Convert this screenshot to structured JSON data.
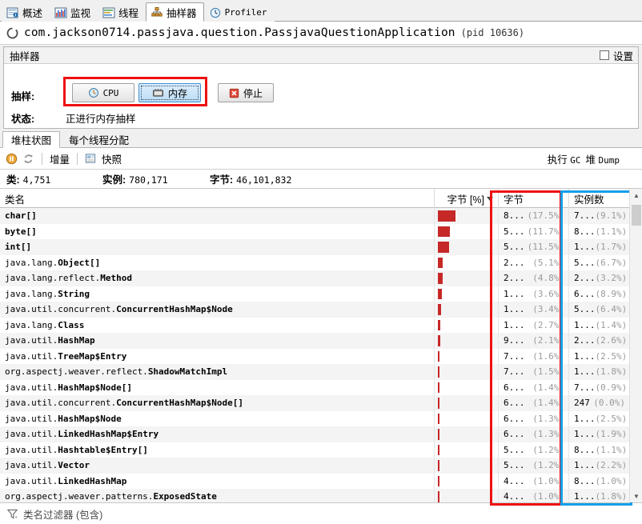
{
  "tabs": [
    {
      "label": "概述",
      "icon": "overview-icon",
      "active": false
    },
    {
      "label": "监视",
      "icon": "monitor-icon",
      "active": false
    },
    {
      "label": "线程",
      "icon": "threads-icon",
      "active": false
    },
    {
      "label": "抽样器",
      "icon": "sampler-icon",
      "active": true
    },
    {
      "label": "Profiler",
      "icon": "profiler-icon",
      "active": false
    }
  ],
  "header": {
    "app_name": "com.jackson0714.passjava.question.PassjavaQuestionApplication",
    "pid": "(pid 10636)",
    "status_icon": "loading-spinner-icon"
  },
  "panel": {
    "title": "抽样器",
    "settings_label": "设置",
    "settings_checked": false,
    "sampling_label": "抽样:",
    "status_label": "状态:",
    "status_value": "正进行内存抽样",
    "buttons": {
      "cpu": {
        "label": "CPU",
        "icon": "clock-icon"
      },
      "memory": {
        "label": "内存",
        "icon": "memory-chip-icon",
        "selected": true
      },
      "stop": {
        "label": "停止",
        "icon": "stop-red-x-icon"
      }
    }
  },
  "subtabs": [
    {
      "label": "堆柱状图",
      "active": true
    },
    {
      "label": "每个线程分配",
      "active": false
    }
  ],
  "toolbar": {
    "pause_icon": "pause-icon",
    "refresh_icon": "refresh-icon",
    "delta_label": "增量",
    "snapshot_icon": "snapshot-icon",
    "snapshot_label": "快照",
    "gc_prefix": "执行",
    "gc_label": "GC",
    "heap_prefix": "堆",
    "dump_label": "Dump"
  },
  "stats": {
    "classes_label": "类:",
    "classes_value": "4,751",
    "instances_label": "实例:",
    "instances_value": "780,171",
    "bytes_label": "字节:",
    "bytes_value": "46,101,832"
  },
  "table": {
    "headers": {
      "name": "类名",
      "percent": "字节 [%]",
      "bytes": "字节",
      "instances": "实例数"
    },
    "sort_column": "percent",
    "sort_direction": "desc",
    "rows": [
      {
        "pkg": "",
        "cls": "char[]",
        "bar_pct": 17.5,
        "bytes": "8...",
        "bytes_pct": "(17.5%)",
        "inst": "7...",
        "inst_pct": "(9.1%)"
      },
      {
        "pkg": "",
        "cls": "byte[]",
        "bar_pct": 11.7,
        "bytes": "5...",
        "bytes_pct": "(11.7%)",
        "inst": "8...",
        "inst_pct": "(1.1%)"
      },
      {
        "pkg": "",
        "cls": "int[]",
        "bar_pct": 11.5,
        "bytes": "5...",
        "bytes_pct": "(11.5%)",
        "inst": "1...",
        "inst_pct": "(1.7%)"
      },
      {
        "pkg": "java.lang.",
        "cls": "Object[]",
        "bar_pct": 5.1,
        "bytes": "2...",
        "bytes_pct": "(5.1%)",
        "inst": "5...",
        "inst_pct": "(6.7%)"
      },
      {
        "pkg": "java.lang.reflect.",
        "cls": "Method",
        "bar_pct": 4.8,
        "bytes": "2...",
        "bytes_pct": "(4.8%)",
        "inst": "2...",
        "inst_pct": "(3.2%)"
      },
      {
        "pkg": "java.lang.",
        "cls": "String",
        "bar_pct": 3.6,
        "bytes": "1...",
        "bytes_pct": "(3.6%)",
        "inst": "6...",
        "inst_pct": "(8.9%)"
      },
      {
        "pkg": "java.util.concurrent.",
        "cls": "ConcurrentHashMap$Node",
        "bar_pct": 3.4,
        "bytes": "1...",
        "bytes_pct": "(3.4%)",
        "inst": "5...",
        "inst_pct": "(6.4%)"
      },
      {
        "pkg": "java.lang.",
        "cls": "Class",
        "bar_pct": 2.7,
        "bytes": "1...",
        "bytes_pct": "(2.7%)",
        "inst": "1...",
        "inst_pct": "(1.4%)"
      },
      {
        "pkg": "java.util.",
        "cls": "HashMap",
        "bar_pct": 2.1,
        "bytes": "9...",
        "bytes_pct": "(2.1%)",
        "inst": "2...",
        "inst_pct": "(2.6%)"
      },
      {
        "pkg": "java.util.",
        "cls": "TreeMap$Entry",
        "bar_pct": 1.6,
        "bytes": "7...",
        "bytes_pct": "(1.6%)",
        "inst": "1...",
        "inst_pct": "(2.5%)"
      },
      {
        "pkg": "org.aspectj.weaver.reflect.",
        "cls": "ShadowMatchImpl",
        "bar_pct": 1.5,
        "bytes": "7...",
        "bytes_pct": "(1.5%)",
        "inst": "1...",
        "inst_pct": "(1.8%)"
      },
      {
        "pkg": "java.util.",
        "cls": "HashMap$Node[]",
        "bar_pct": 1.4,
        "bytes": "6...",
        "bytes_pct": "(1.4%)",
        "inst": "7...",
        "inst_pct": "(0.9%)"
      },
      {
        "pkg": "java.util.concurrent.",
        "cls": "ConcurrentHashMap$Node[]",
        "bar_pct": 1.4,
        "bytes": "6...",
        "bytes_pct": "(1.4%)",
        "inst": "247",
        "inst_pct": "(0.0%)"
      },
      {
        "pkg": "java.util.",
        "cls": "HashMap$Node",
        "bar_pct": 1.3,
        "bytes": "6...",
        "bytes_pct": "(1.3%)",
        "inst": "1...",
        "inst_pct": "(2.5%)"
      },
      {
        "pkg": "java.util.",
        "cls": "LinkedHashMap$Entry",
        "bar_pct": 1.3,
        "bytes": "6...",
        "bytes_pct": "(1.3%)",
        "inst": "1...",
        "inst_pct": "(1.9%)"
      },
      {
        "pkg": "java.util.",
        "cls": "Hashtable$Entry[]",
        "bar_pct": 1.2,
        "bytes": "5...",
        "bytes_pct": "(1.2%)",
        "inst": "8...",
        "inst_pct": "(1.1%)"
      },
      {
        "pkg": "java.util.",
        "cls": "Vector",
        "bar_pct": 1.2,
        "bytes": "5...",
        "bytes_pct": "(1.2%)",
        "inst": "1...",
        "inst_pct": "(2.2%)"
      },
      {
        "pkg": "java.util.",
        "cls": "LinkedHashMap",
        "bar_pct": 1.0,
        "bytes": "4...",
        "bytes_pct": "(1.0%)",
        "inst": "8...",
        "inst_pct": "(1.0%)"
      },
      {
        "pkg": "org.aspectj.weaver.patterns.",
        "cls": "ExposedState",
        "bar_pct": 1.0,
        "bytes": "4...",
        "bytes_pct": "(1.0%)",
        "inst": "1...",
        "inst_pct": "(1.8%)"
      }
    ]
  },
  "filter": {
    "icon": "funnel-filter-icon",
    "label": "类名过滤器 (包含)"
  },
  "colors": {
    "bar": "#c62828",
    "highlight_red": "#ee1111",
    "highlight_blue": "#12a0e8",
    "selected_button": "#bcdcf5"
  }
}
